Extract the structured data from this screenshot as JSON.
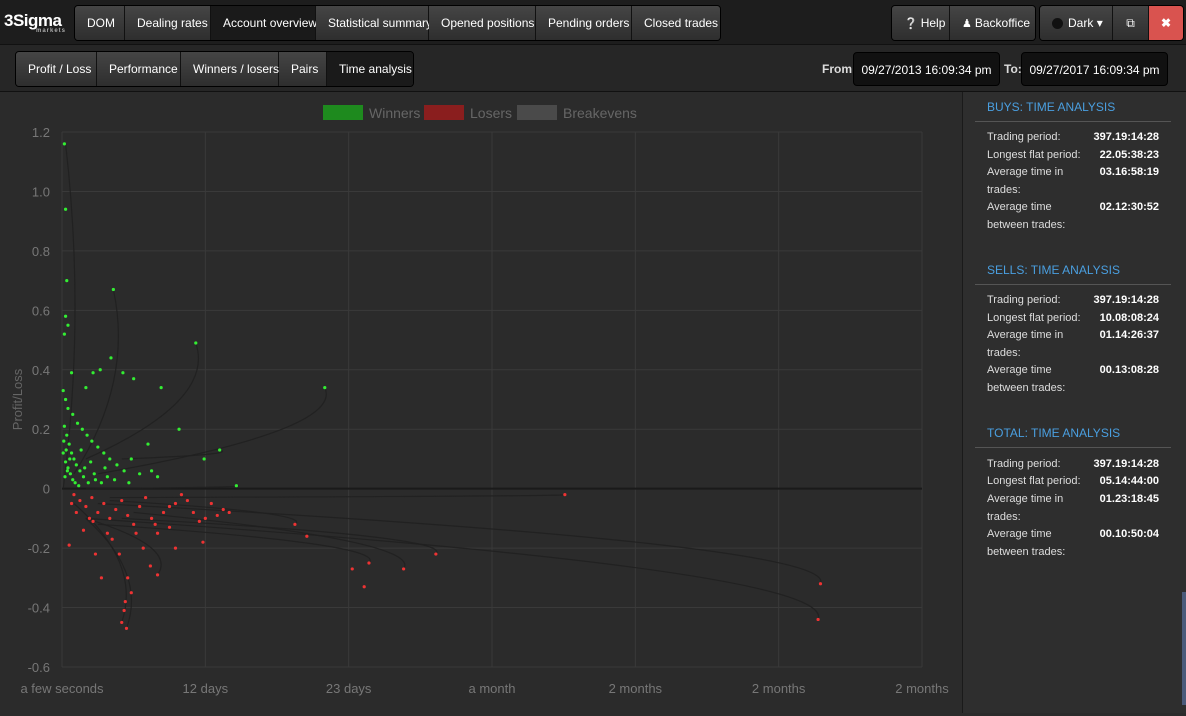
{
  "logo": {
    "name": "3Sigma",
    "sub": "markets"
  },
  "top_nav": [
    "DOM",
    "Dealing rates",
    "Account overview",
    "Statistical summary",
    "Opened positions",
    "Pending orders",
    "Closed trades"
  ],
  "top_right": {
    "help": "Help",
    "backoffice": "Backoffice",
    "theme": "Dark"
  },
  "sub_nav": [
    "Profit / Loss",
    "Performance",
    "Winners / losers",
    "Pairs",
    "Time analysis"
  ],
  "date_range": {
    "from_label": "From:",
    "from": "09/27/2013 16:09:34 pm",
    "to_label": "To:",
    "to": "09/27/2017 16:09:34 pm"
  },
  "sidebar": {
    "sections": [
      {
        "title": "BUYS: TIME ANALYSIS",
        "rows": [
          {
            "k": "Trading period:",
            "v": "397.19:14:28"
          },
          {
            "k": "Longest flat period:",
            "v": "22.05:38:23"
          },
          {
            "k": "Average time in trades:",
            "v": "03.16:58:19"
          },
          {
            "k": "Average time between trades:",
            "v": "02.12:30:52"
          }
        ]
      },
      {
        "title": "SELLS: TIME ANALYSIS",
        "rows": [
          {
            "k": "Trading period:",
            "v": "397.19:14:28"
          },
          {
            "k": "Longest flat period:",
            "v": "10.08:08:24"
          },
          {
            "k": "Average time in trades:",
            "v": "01.14:26:37"
          },
          {
            "k": "Average time between trades:",
            "v": "00.13:08:28"
          }
        ]
      },
      {
        "title": "TOTAL: TIME ANALYSIS",
        "rows": [
          {
            "k": "Trading period:",
            "v": "397.19:14:28"
          },
          {
            "k": "Longest flat period:",
            "v": "05.14:44:00"
          },
          {
            "k": "Average time in trades:",
            "v": "01.23:18:45"
          },
          {
            "k": "Average time between trades:",
            "v": "00.10:50:04"
          }
        ]
      }
    ]
  },
  "colors": {
    "winners": "#1e8a1e",
    "losers": "#8a1e1e",
    "breakevens": "#4a4a4a",
    "win_point": "#33ee33",
    "loss_point": "#ee3333",
    "accent": "#4a9fe0"
  },
  "chart_data": {
    "type": "scatter",
    "ylabel": "Profit/Loss",
    "xlabel": "",
    "legend": [
      "Winners",
      "Losers",
      "Breakevens"
    ],
    "legend_position": "top-center",
    "ylim": [
      -0.6,
      1.2
    ],
    "y_ticks": [
      "1.2",
      "1.0",
      "0.8",
      "0.6",
      "0.4",
      "0.2",
      "0",
      "-0.2",
      "-0.4",
      "-0.6"
    ],
    "x_ticks": [
      "a few seconds",
      "12 days",
      "23 days",
      "a month",
      "2 months",
      "2 months",
      "2 months"
    ],
    "x_unit": "days",
    "xlim": [
      0,
      72
    ],
    "series": [
      {
        "name": "Winners",
        "points": [
          [
            0.2,
            1.16
          ],
          [
            0.3,
            0.94
          ],
          [
            0.4,
            0.7
          ],
          [
            0.3,
            0.58
          ],
          [
            0.5,
            0.55
          ],
          [
            0.2,
            0.52
          ],
          [
            4.3,
            0.67
          ],
          [
            4.1,
            0.44
          ],
          [
            11.2,
            0.49
          ],
          [
            22,
            0.34
          ],
          [
            8.3,
            0.34
          ],
          [
            0.8,
            0.39
          ],
          [
            2,
            0.34
          ],
          [
            2.6,
            0.39
          ],
          [
            3.2,
            0.4
          ],
          [
            5.1,
            0.39
          ],
          [
            6,
            0.37
          ],
          [
            13.2,
            0.13
          ],
          [
            11.9,
            0.1
          ],
          [
            14.6,
            0.01
          ],
          [
            7.5,
            0.06
          ],
          [
            0.1,
            0.33
          ],
          [
            0.3,
            0.3
          ],
          [
            0.5,
            0.27
          ],
          [
            0.9,
            0.25
          ],
          [
            1.3,
            0.22
          ],
          [
            1.7,
            0.2
          ],
          [
            2.1,
            0.18
          ],
          [
            2.5,
            0.16
          ],
          [
            3,
            0.14
          ],
          [
            3.5,
            0.12
          ],
          [
            4,
            0.1
          ],
          [
            4.6,
            0.08
          ],
          [
            5.2,
            0.06
          ],
          [
            0.2,
            0.21
          ],
          [
            0.4,
            0.18
          ],
          [
            0.6,
            0.15
          ],
          [
            0.8,
            0.12
          ],
          [
            1,
            0.1
          ],
          [
            1.2,
            0.08
          ],
          [
            1.5,
            0.06
          ],
          [
            1.8,
            0.04
          ],
          [
            2.2,
            0.02
          ],
          [
            0.1,
            0.12
          ],
          [
            0.3,
            0.09
          ],
          [
            0.5,
            0.07
          ],
          [
            0.7,
            0.05
          ],
          [
            0.9,
            0.03
          ],
          [
            1.1,
            0.02
          ],
          [
            1.4,
            0.01
          ],
          [
            2.8,
            0.03
          ],
          [
            3.3,
            0.02
          ],
          [
            3.8,
            0.04
          ],
          [
            6.5,
            0.05
          ],
          [
            0.15,
            0.16
          ],
          [
            0.35,
            0.13
          ],
          [
            0.65,
            0.1
          ],
          [
            1.6,
            0.13
          ],
          [
            2.4,
            0.09
          ],
          [
            3.6,
            0.07
          ],
          [
            4.4,
            0.03
          ],
          [
            5.6,
            0.02
          ],
          [
            0.25,
            0.04
          ],
          [
            0.45,
            0.06
          ],
          [
            1.9,
            0.07
          ],
          [
            2.7,
            0.05
          ],
          [
            9.8,
            0.2
          ],
          [
            7.2,
            0.15
          ],
          [
            5.8,
            0.1
          ],
          [
            8,
            0.04
          ]
        ]
      },
      {
        "name": "Losers",
        "points": [
          [
            1,
            -0.02
          ],
          [
            1.5,
            -0.04
          ],
          [
            2,
            -0.06
          ],
          [
            2.5,
            -0.03
          ],
          [
            3,
            -0.08
          ],
          [
            3.5,
            -0.05
          ],
          [
            4,
            -0.1
          ],
          [
            4.5,
            -0.07
          ],
          [
            5,
            -0.04
          ],
          [
            5.5,
            -0.09
          ],
          [
            6,
            -0.12
          ],
          [
            6.5,
            -0.06
          ],
          [
            7,
            -0.03
          ],
          [
            7.5,
            -0.1
          ],
          [
            8,
            -0.15
          ],
          [
            8.5,
            -0.08
          ],
          [
            9,
            -0.13
          ],
          [
            9.5,
            -0.05
          ],
          [
            10,
            -0.02
          ],
          [
            11,
            -0.08
          ],
          [
            11.5,
            -0.11
          ],
          [
            12,
            -0.1
          ],
          [
            12.5,
            -0.05
          ],
          [
            13,
            -0.09
          ],
          [
            13.5,
            -0.07
          ],
          [
            14,
            -0.08
          ],
          [
            19.5,
            -0.12
          ],
          [
            20.5,
            -0.16
          ],
          [
            24.3,
            -0.27
          ],
          [
            25.3,
            -0.33
          ],
          [
            25.7,
            -0.25
          ],
          [
            28.6,
            -0.27
          ],
          [
            31.3,
            -0.22
          ],
          [
            42.1,
            -0.02
          ],
          [
            63.5,
            -0.32
          ],
          [
            63.3,
            -0.44
          ],
          [
            5.5,
            -0.3
          ],
          [
            5.8,
            -0.35
          ],
          [
            5.2,
            -0.41
          ],
          [
            5.3,
            -0.38
          ],
          [
            5,
            -0.45
          ],
          [
            5.4,
            -0.47
          ],
          [
            3.3,
            -0.3
          ],
          [
            0.6,
            -0.19
          ],
          [
            2.8,
            -0.22
          ],
          [
            8,
            -0.29
          ],
          [
            7.4,
            -0.26
          ],
          [
            9.5,
            -0.2
          ],
          [
            11.8,
            -0.18
          ],
          [
            1.8,
            -0.14
          ],
          [
            2.6,
            -0.11
          ],
          [
            4.2,
            -0.17
          ],
          [
            4.8,
            -0.22
          ],
          [
            6.8,
            -0.2
          ],
          [
            3.8,
            -0.15
          ],
          [
            1.2,
            -0.08
          ],
          [
            0.8,
            -0.05
          ],
          [
            2.3,
            -0.1
          ],
          [
            6.2,
            -0.15
          ],
          [
            7.8,
            -0.12
          ],
          [
            9,
            -0.06
          ],
          [
            10.5,
            -0.04
          ]
        ]
      }
    ]
  }
}
